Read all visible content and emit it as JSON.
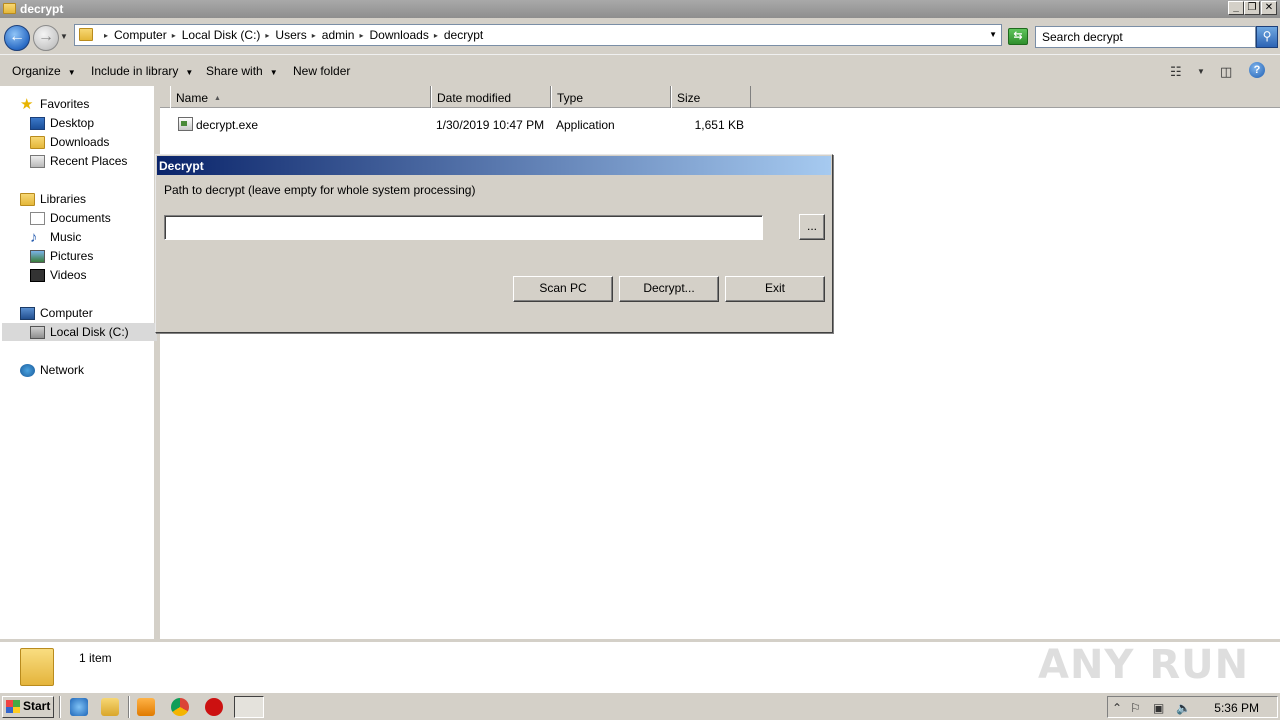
{
  "window": {
    "title": "decrypt"
  },
  "address": {
    "crumbs": [
      "Computer",
      "Local Disk (C:)",
      "Users",
      "admin",
      "Downloads",
      "decrypt"
    ]
  },
  "search": {
    "placeholder": "Search decrypt"
  },
  "toolbar": {
    "organize": "Organize",
    "include_in_library": "Include in library",
    "share_with": "Share with",
    "new_folder": "New folder"
  },
  "nav": {
    "favorites": "Favorites",
    "desktop": "Desktop",
    "downloads": "Downloads",
    "recent_places": "Recent Places",
    "libraries": "Libraries",
    "documents": "Documents",
    "music": "Music",
    "pictures": "Pictures",
    "videos": "Videos",
    "computer": "Computer",
    "local_disk": "Local Disk (C:)",
    "network": "Network"
  },
  "columns": {
    "name": "Name",
    "date_modified": "Date modified",
    "type": "Type",
    "size": "Size"
  },
  "files": [
    {
      "name": "decrypt.exe",
      "date": "1/30/2019 10:47 PM",
      "type": "Application",
      "size": "1,651 KB"
    }
  ],
  "dialog": {
    "title": "Decrypt",
    "prompt": "Path to decrypt (leave empty for whole system processing)",
    "path_value": "",
    "browse_label": "...",
    "scan_label": "Scan PC",
    "decrypt_label": "Decrypt...",
    "exit_label": "Exit"
  },
  "details": {
    "item_count": "1 item"
  },
  "watermark": "ANY RUN",
  "taskbar": {
    "start_label": "Start",
    "clock": "5:36 PM"
  }
}
